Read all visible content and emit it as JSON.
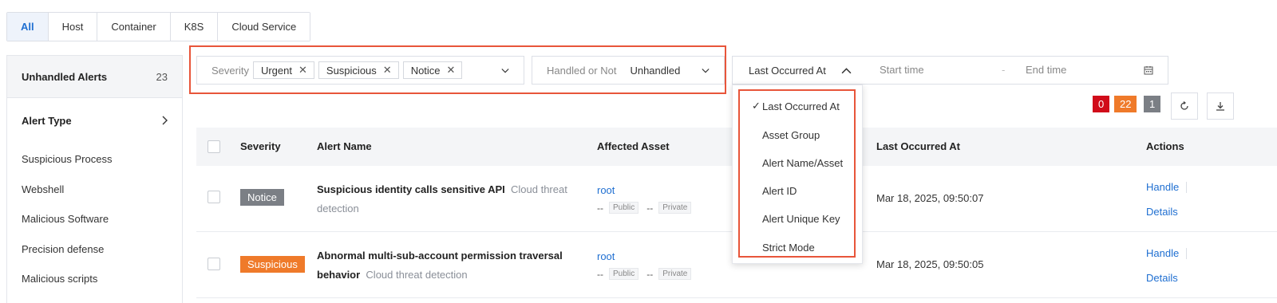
{
  "tabs": [
    "All",
    "Host",
    "Container",
    "K8S",
    "Cloud Service"
  ],
  "sidebar": {
    "unhandled_label": "Unhandled Alerts",
    "unhandled_count": "23",
    "alert_type_label": "Alert Type",
    "items": [
      "Suspicious Process",
      "Webshell",
      "Malicious Software",
      "Precision defense",
      "Malicious scripts"
    ]
  },
  "filters": {
    "severity_label": "Severity",
    "severity_chips": [
      "Urgent",
      "Suspicious",
      "Notice"
    ],
    "handled_label": "Handled or Not",
    "handled_value": "Unhandled",
    "time_field": "Last Occurred At",
    "start_placeholder": "Start time",
    "end_placeholder": "End time",
    "separator": "-"
  },
  "badges": {
    "urgent": "0",
    "suspicious": "22",
    "notice": "1"
  },
  "table": {
    "headers": {
      "severity": "Severity",
      "alert_name": "Alert Name",
      "affected_asset": "Affected Asset",
      "last_occurred": "Last Occurred At",
      "actions": "Actions"
    },
    "rows": [
      {
        "severity": "Notice",
        "name": "Suspicious identity calls sensitive API",
        "category": "Cloud threat detection",
        "asset": "root",
        "public": "--",
        "public_tag": "Public",
        "private": "--",
        "private_tag": "Private",
        "occurred": "Mar 18, 2025, 09:50:07",
        "handle": "Handle",
        "details": "Details"
      },
      {
        "severity": "Suspicious",
        "name": "Abnormal multi-sub-account permission traversal behavior",
        "category": "Cloud threat detection",
        "asset": "root",
        "public": "--",
        "public_tag": "Public",
        "private": "--",
        "private_tag": "Private",
        "occurred": "Mar 18, 2025, 09:50:05",
        "handle": "Handle",
        "details": "Details"
      }
    ]
  },
  "dropdown": {
    "items": [
      "Last Occurred At",
      "Asset Group",
      "Alert Name/Asset",
      "Alert ID",
      "Alert Unique Key",
      "Strict Mode"
    ],
    "selected_index": 0
  },
  "colors": {
    "accent": "#1f6fd1",
    "urgent": "#d10c1a",
    "suspicious": "#ef7a2a",
    "notice": "#7b7f85",
    "highlight": "#e8553a"
  }
}
